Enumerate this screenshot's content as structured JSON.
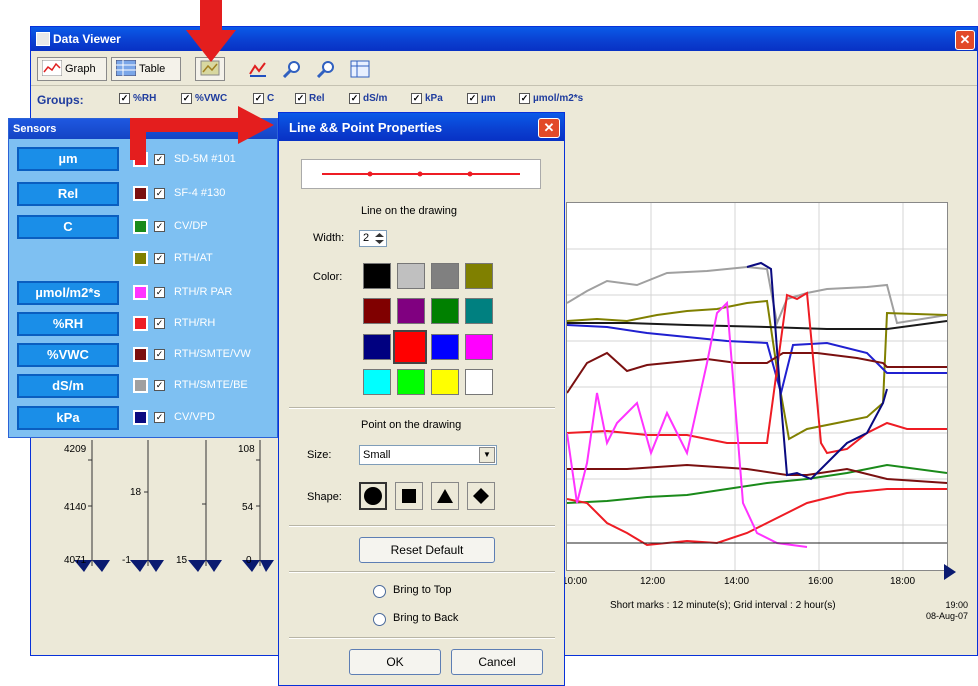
{
  "window": {
    "title": "Data Viewer",
    "close_glyph": "✕"
  },
  "toolbar": {
    "graph_label": "Graph",
    "table_label": "Table",
    "icons": [
      "line-properties-icon",
      "chart-icon",
      "zoom-in-icon",
      "zoom-out-icon",
      "grid-icon"
    ]
  },
  "groups_bar": {
    "label": "Groups:",
    "checkmark": "✓",
    "items": [
      "%RH",
      "%VWC",
      "C",
      "Rel",
      "dS/m",
      "kPa",
      "µm",
      "µmol/m2*s"
    ]
  },
  "sensors_panel": {
    "title": "Sensors",
    "checkmark": "✓",
    "groups": [
      "µm",
      "Rel",
      "C",
      "µmol/m2*s",
      "%RH",
      "%VWC",
      "dS/m",
      "kPa"
    ],
    "rows": [
      {
        "name": "SD-5M #101",
        "color": "#ee1c24"
      },
      {
        "name": "SF-4 #130",
        "color": "#7a1010"
      },
      {
        "name": "CV/DP",
        "color": "#1a8a1a"
      },
      {
        "name": "RTH/AT",
        "color": "#808000"
      },
      {
        "name": "RTH/R PAR",
        "color": "#ff33ff"
      },
      {
        "name": "RTH/RH",
        "color": "#ee1c24"
      },
      {
        "name": "RTH/SMTE/VW",
        "color": "#7a1010"
      },
      {
        "name": "RTH/SMTE/BE",
        "color": "#a0a0a0"
      },
      {
        "name": "CV/VPD",
        "color": "#0a0a80"
      }
    ]
  },
  "dialog": {
    "title": "Line && Point Properties",
    "close_glyph": "✕",
    "line_section": "Line on the drawing",
    "width_label": "Width:",
    "width_value": "2",
    "color_label": "Color:",
    "colors": [
      "#000000",
      "#c0c0c0",
      "#808080",
      "#808000",
      "#800000",
      "#800080",
      "#008000",
      "#008080",
      "#000080",
      "#ff0000",
      "#0000ff",
      "#ff00ff",
      "#00ffff",
      "#00ff00",
      "#ffff00",
      "#ffffff"
    ],
    "selected_color": "#ff0000",
    "point_section": "Point on the drawing",
    "size_label": "Size:",
    "size_value": "Small",
    "shape_label": "Shape:",
    "shapes": [
      "circle",
      "square",
      "triangle",
      "diamond"
    ],
    "reset_label": "Reset Default",
    "bring_top": "Bring to Top",
    "bring_back": "Bring to Back",
    "ok": "OK",
    "cancel": "Cancel"
  },
  "graph": {
    "x_ticks": [
      "10:00",
      "12:00",
      "14:00",
      "16:00",
      "18:00"
    ],
    "short_marks": "Short marks : 12 minute(s); Grid interval : 2 hour(s)",
    "end_time": "19:00",
    "end_date": "08-Aug-07",
    "axis_labels": [
      {
        "text": "4209"
      },
      {
        "text": "4140"
      },
      {
        "text": "4071"
      },
      {
        "text": "-1"
      },
      {
        "text": "18"
      },
      {
        "text": "15"
      },
      {
        "text": "108"
      },
      {
        "text": "54"
      },
      {
        "text": "0"
      }
    ]
  }
}
